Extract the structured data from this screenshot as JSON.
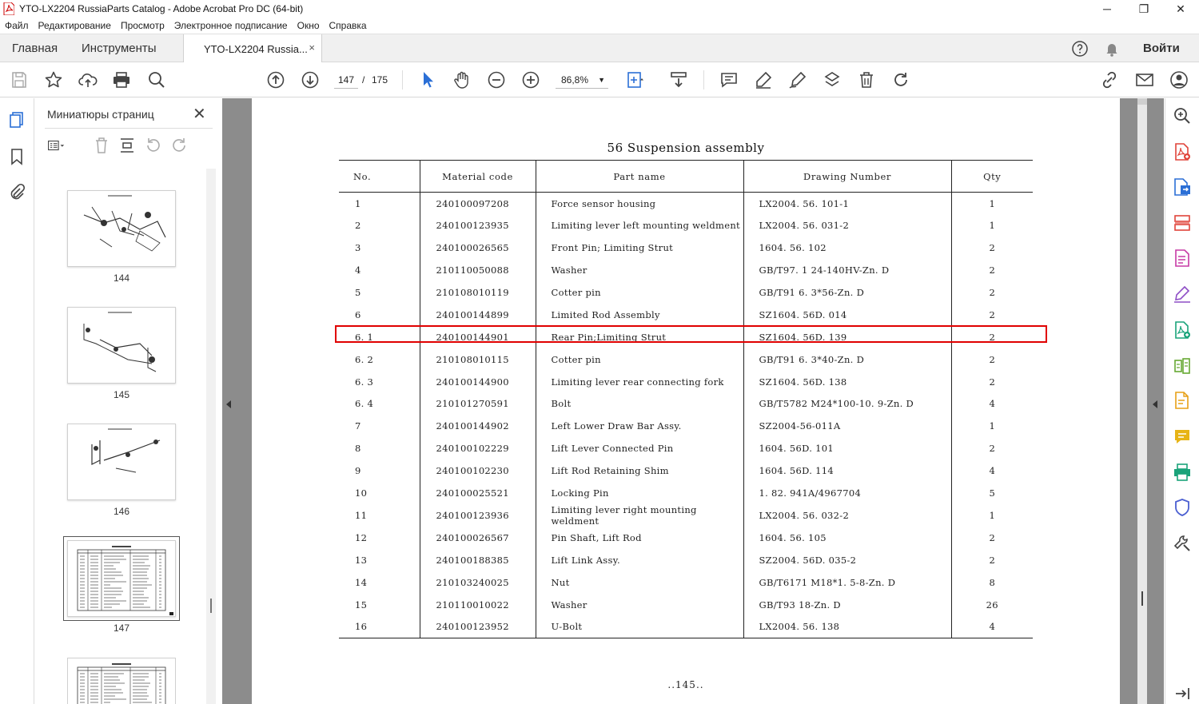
{
  "window": {
    "title": "YTO-LX2204 RussiaParts Catalog - Adobe Acrobat Pro DC (64-bit)",
    "minimize": "─",
    "maximize": "❐",
    "close": "✕"
  },
  "menu": [
    "Файл",
    "Редактирование",
    "Просмотр",
    "Электронное подписание",
    "Окно",
    "Справка"
  ],
  "tabs": {
    "home": "Главная",
    "tools": "Инструменты",
    "document": "YTO-LX2204 Russia...",
    "close": "×",
    "signin": "Войти"
  },
  "toolbar": {
    "page_current": "147",
    "page_separator": "/",
    "page_total": "175",
    "zoom": "86,8%"
  },
  "thumbnails": {
    "panel_title": "Миниатюры страниц",
    "close": "✕",
    "pages": [
      {
        "label": "144"
      },
      {
        "label": "145"
      },
      {
        "label": "146"
      },
      {
        "label": "147",
        "selected": true
      },
      {
        "label": ""
      }
    ]
  },
  "document": {
    "heading": "56 Suspension assembly",
    "columns": [
      "No.",
      "Material code",
      "Part name",
      "Drawing Number",
      "Qty"
    ],
    "rows": [
      [
        "1",
        "240100097208",
        "Force sensor housing",
        "LX2004. 56. 101-1",
        "1"
      ],
      [
        "2",
        "240100123935",
        "Limiting lever left mounting weldment",
        "LX2004. 56. 031-2",
        "1"
      ],
      [
        "3",
        "240100026565",
        "Front Pin; Limiting Strut",
        "1604. 56. 102",
        "2"
      ],
      [
        "4",
        "210110050088",
        "Washer",
        "GB/T97. 1 24-140HV-Zn. D",
        "2"
      ],
      [
        "5",
        "210108010119",
        "Cotter pin",
        "GB/T91 6. 3*56-Zn. D",
        "2"
      ],
      [
        "6",
        "240100144899",
        "Limited Rod Assembly",
        "SZ1604. 56D. 014",
        "2"
      ],
      [
        "6. 1",
        "240100144901",
        "Rear Pin;Limiting Strut",
        "SZ1604. 56D. 139",
        "2"
      ],
      [
        "6. 2",
        "210108010115",
        "Cotter pin",
        "GB/T91 6. 3*40-Zn. D",
        "2"
      ],
      [
        "6. 3",
        "240100144900",
        "Limiting lever rear connecting fork",
        "SZ1604. 56D. 138",
        "2"
      ],
      [
        "6. 4",
        "210101270591",
        "Bolt",
        "GB/T5782 M24*100-10. 9-Zn. D",
        "4"
      ],
      [
        "7",
        "240100144902",
        "Left Lower Draw Bar Assy.",
        "SZ2004-56-011A",
        "1"
      ],
      [
        "8",
        "240100102229",
        "Lift Lever Connected Pin",
        "1604. 56D. 101",
        "2"
      ],
      [
        "9",
        "240100102230",
        "Lift Rod Retaining Shim",
        "1604. 56D. 114",
        "4"
      ],
      [
        "10",
        "240100025521",
        "Locking Pin",
        "1. 82. 941A/4967704",
        "5"
      ],
      [
        "11",
        "240100123936",
        "Limiting lever right mounting weldment",
        "LX2004. 56. 032-2",
        "1"
      ],
      [
        "12",
        "240100026567",
        "Pin Shaft, Lift Rod",
        "1604. 56. 105",
        "2"
      ],
      [
        "13",
        "240100188385",
        "Lift Link Assy.",
        "SZ2004. 56D. 035-2",
        "2"
      ],
      [
        "14",
        "210103240025",
        "Nut",
        "GB/T6171 M18*1. 5-8-Zn. D",
        "8"
      ],
      [
        "15",
        "210110010022",
        "Washer",
        "GB/T93 18-Zn. D",
        "26"
      ],
      [
        "16",
        "240100123952",
        "U-Bolt",
        "LX2004. 56. 138",
        "4"
      ]
    ],
    "footer": "..145..",
    "highlighted_row": "6. 1"
  },
  "colors": {
    "highlight": "#e00000",
    "accent": "#2b6fd6",
    "doc_background": "#8c8c8c"
  },
  "icons": {
    "toolbar": [
      "save-icon",
      "star-icon",
      "upload-icon",
      "print-icon",
      "search-icon",
      "page-up-icon",
      "page-down-icon",
      "zoom-out-icon",
      "zoom-in-icon",
      "select-arrow-icon",
      "hand-icon",
      "fit-page-icon",
      "scroll-mode-icon",
      "comment-icon",
      "highlight-pen-icon",
      "sign-icon",
      "fill-sign-icon",
      "delete-icon",
      "rotate-icon",
      "link-icon",
      "email-icon",
      "share-user-icon"
    ],
    "right_rail": [
      "zoom-search-icon",
      "create-pdf-icon",
      "export-pdf-icon",
      "organize-pages-icon",
      "edit-pdf-icon",
      "fill-sign-icon",
      "create-form-icon",
      "compare-icon",
      "send-review-icon",
      "comment-icon",
      "print-production-icon",
      "protect-icon",
      "more-tools-icon",
      "collapse-panel-icon"
    ]
  }
}
